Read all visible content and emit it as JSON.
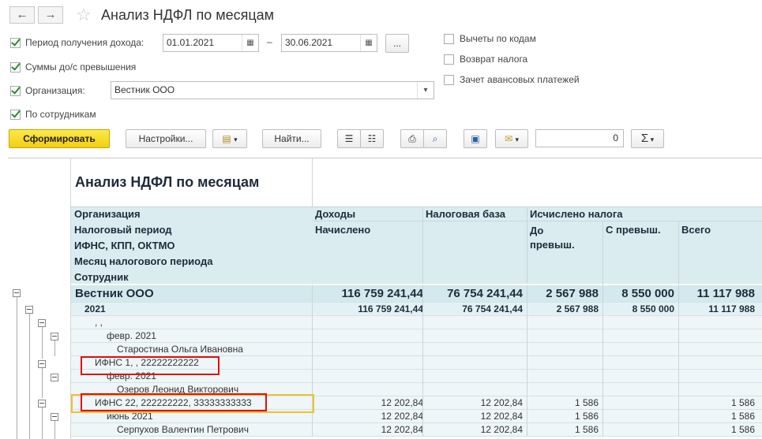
{
  "window": {
    "title": "Анализ НДФЛ по месяцам",
    "back": "←",
    "forward": "→"
  },
  "form": {
    "period_label": "Период получения дохода:",
    "date_from": "01.01.2021",
    "date_sep": "–",
    "date_to": "30.06.2021",
    "period_more": "...",
    "sums_label": "Суммы до/с превышения",
    "org_label": "Организация:",
    "org_value": "Вестник ООО",
    "by_employees_label": "По сотрудникам",
    "deductions_label": "Вычеты по кодам",
    "tax_refund_label": "Возврат налога",
    "advance_label": "Зачет авансовых платежей"
  },
  "toolbar": {
    "generate": "Сформировать",
    "settings": "Настройки...",
    "find": "Найти...",
    "sum_value": "0",
    "sigma": "Σ"
  },
  "report": {
    "title": "Анализ НДФЛ по месяцам",
    "grouping_headers": [
      "Организация",
      "Налоговый период",
      "ИФНС, КПП, ОКТМО",
      "Месяц налогового периода",
      "Сотрудник"
    ],
    "col_income": "Доходы",
    "col_income_sub": "Начислено",
    "col_base": "Налоговая база",
    "col_tax": "Исчислено налога",
    "col_tax_before": "До превыш.",
    "col_tax_after": "С превыш.",
    "col_tax_total": "Всего",
    "rows": [
      {
        "label": "Вестник ООО",
        "income": "116 759 241,44",
        "base": "76 754 241,44",
        "before": "2 567 988",
        "after": "8 550 000",
        "total": "11 117 988"
      },
      {
        "label": "2021",
        "income": "116 759 241,44",
        "base": "76 754 241,44",
        "before": "2 567 988",
        "after": "8 550 000",
        "total": "11 117 988"
      },
      {
        "label": ", ,",
        "income": "",
        "base": "",
        "before": "",
        "after": "",
        "total": ""
      },
      {
        "label": "февр. 2021",
        "income": "",
        "base": "",
        "before": "",
        "after": "",
        "total": ""
      },
      {
        "label": "Старостина Ольга Ивановна",
        "income": "",
        "base": "",
        "before": "",
        "after": "",
        "total": ""
      },
      {
        "label": "ИФНС 1, , 22222222222",
        "income": "",
        "base": "",
        "before": "",
        "after": "",
        "total": ""
      },
      {
        "label": "февр. 2021",
        "income": "",
        "base": "",
        "before": "",
        "after": "",
        "total": ""
      },
      {
        "label": "Озеров Леонид Викторович",
        "income": "",
        "base": "",
        "before": "",
        "after": "",
        "total": ""
      },
      {
        "label": "ИФНС 22, 222222222, 33333333333",
        "income": "12 202,84",
        "base": "12 202,84",
        "before": "1 586",
        "after": "",
        "total": "1 586"
      },
      {
        "label": "июнь 2021",
        "income": "12 202,84",
        "base": "12 202,84",
        "before": "1 586",
        "after": "",
        "total": "1 586"
      },
      {
        "label": "Серпухов Валентин Петрович",
        "income": "12 202,84",
        "base": "12 202,84",
        "before": "1 586",
        "after": "",
        "total": "1 586"
      }
    ]
  }
}
